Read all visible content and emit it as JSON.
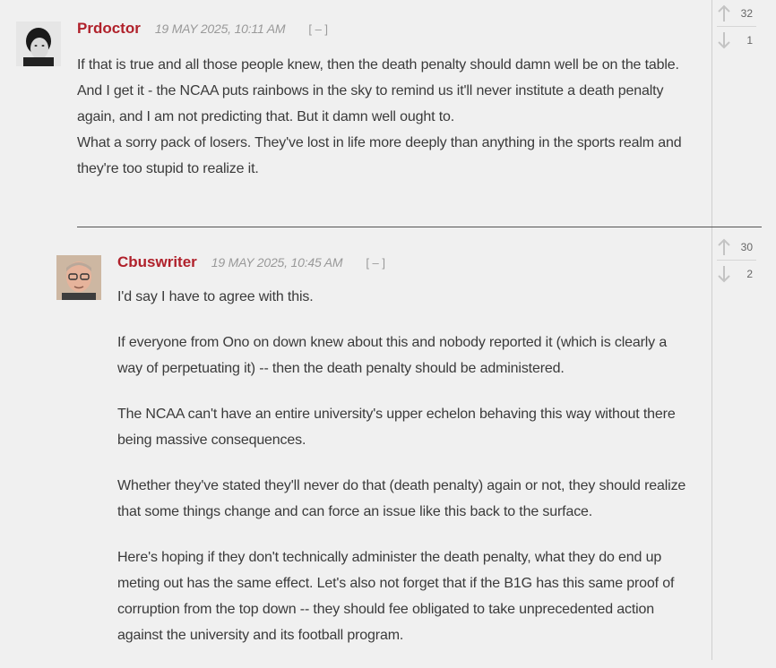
{
  "comments": [
    {
      "author": "Prdoctor",
      "date": "19 MAY 2025, 10:11 AM",
      "collapse_label": "[ – ]",
      "upvotes": "32",
      "downvotes": "1",
      "paragraphs": [
        "If that is true and all those people knew, then the death penalty should damn well be on the table.",
        "And I get it - the NCAA puts rainbows in the sky to remind us it'll never institute a death penalty again, and I am not predicting that. But it damn well ought to.",
        "What a sorry pack of losers. They've lost in life more deeply than anything in the sports realm and they're too stupid to realize it."
      ]
    },
    {
      "author": "Cbuswriter",
      "date": "19 MAY 2025, 10:45 AM",
      "collapse_label": "[ – ]",
      "upvotes": "30",
      "downvotes": "2",
      "paragraphs": [
        "I'd say I have to agree with this.",
        "If everyone from Ono on down knew about this and nobody reported it (which is clearly a way of perpetuating it) -- then the death penalty should be administered.",
        "The NCAA can't have an entire university's upper echelon behaving this way without there being massive consequences.",
        "Whether they've stated they'll never do that (death penalty) again or not, they should realize that some things change and can force an issue like this back to the surface.",
        "Here's hoping if they don't technically administer the death penalty, what they do end up meting out has the same effect. Let's also not forget that if the B1G has this same proof of corruption from the top down -- they should fee obligated to take unprecedented action against the university and its football program."
      ]
    }
  ],
  "icons": {
    "upvote": "arrow-up-icon",
    "downvote": "arrow-down-icon"
  },
  "colors": {
    "author": "#b0212b",
    "background": "#f0f0f0",
    "meta": "#999999"
  }
}
